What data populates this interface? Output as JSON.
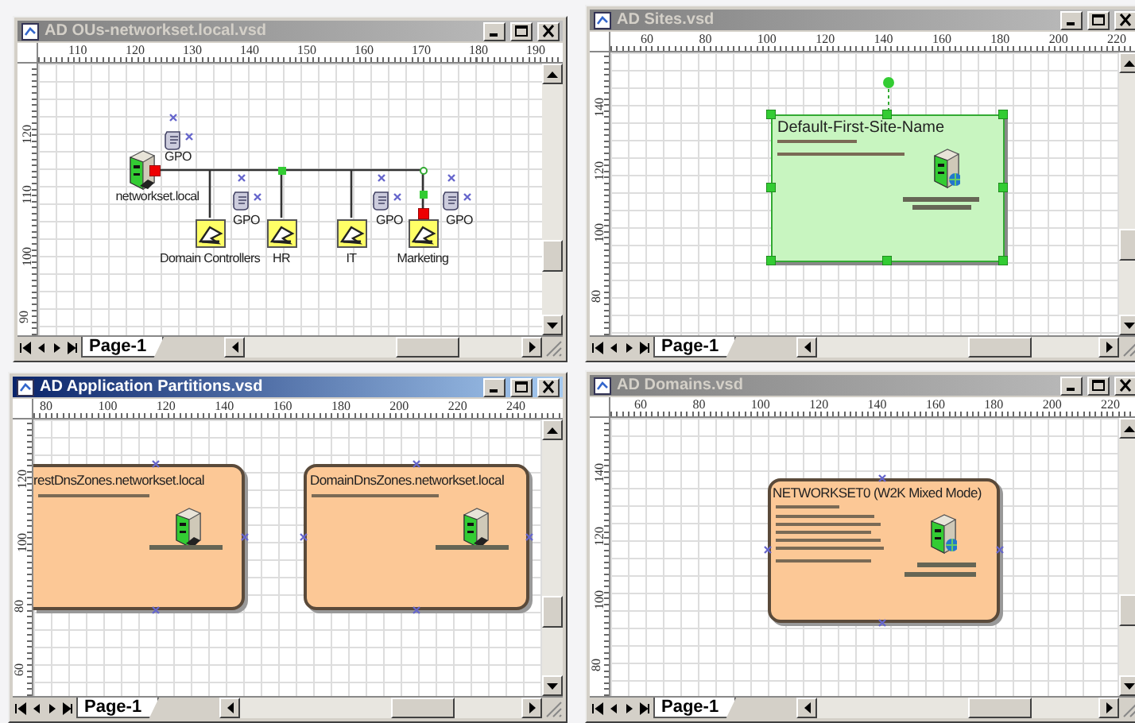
{
  "windows": [
    {
      "kind": "ous",
      "title": "AD OUs-networkset.local.vsd",
      "active": false,
      "hruler": [
        "110",
        "120",
        "130",
        "140",
        "150",
        "160",
        "170",
        "180",
        "190"
      ],
      "vruler": [
        "120",
        "110",
        "100",
        "90"
      ],
      "page_tabs": [
        {
          "label": "Page-1",
          "selected": true
        }
      ],
      "diagram": {
        "domain": {
          "label": "networkset.local"
        },
        "gpos": [
          {
            "label": "GPO"
          },
          {
            "label": "GPO"
          },
          {
            "label": "GPO"
          },
          {
            "label": "GPO"
          }
        ],
        "ous": [
          {
            "label": "Domain Controllers"
          },
          {
            "label": "HR"
          },
          {
            "label": "IT"
          },
          {
            "label": "Marketing"
          }
        ]
      }
    },
    {
      "kind": "sites",
      "title": "AD Sites.vsd",
      "active": false,
      "hruler": [
        "60",
        "80",
        "100",
        "120",
        "140",
        "160",
        "180",
        "200",
        "220"
      ],
      "vruler": [
        "140",
        "120",
        "100",
        "80"
      ],
      "page_tabs": [
        {
          "label": "Page-1",
          "selected": true
        }
      ],
      "diagram": {
        "sites": [
          {
            "name": "Default-First-Site-Name",
            "selected": true
          }
        ]
      }
    },
    {
      "kind": "partitions",
      "title": "AD Application Partitions.vsd",
      "active": true,
      "hruler": [
        "80",
        "100",
        "120",
        "140",
        "160",
        "180",
        "200",
        "220",
        "240"
      ],
      "vruler": [
        "120",
        "100",
        "80",
        "60"
      ],
      "page_tabs": [
        {
          "label": "Page-1",
          "selected": true
        }
      ],
      "diagram": {
        "partitions": [
          {
            "name": "restDnsZones.networkset.local"
          },
          {
            "name": "DomainDnsZones.networkset.local"
          }
        ]
      }
    },
    {
      "kind": "domains",
      "title": "AD Domains.vsd",
      "active": false,
      "hruler": [
        "60",
        "80",
        "100",
        "120",
        "140",
        "160",
        "180",
        "200",
        "220"
      ],
      "vruler": [
        "140",
        "120",
        "100",
        "80"
      ],
      "page_tabs": [
        {
          "label": "Page-1",
          "selected": true
        }
      ],
      "diagram": {
        "domains": [
          {
            "name": "NETWORKSET0 (W2K Mixed Mode)"
          }
        ]
      }
    }
  ]
}
